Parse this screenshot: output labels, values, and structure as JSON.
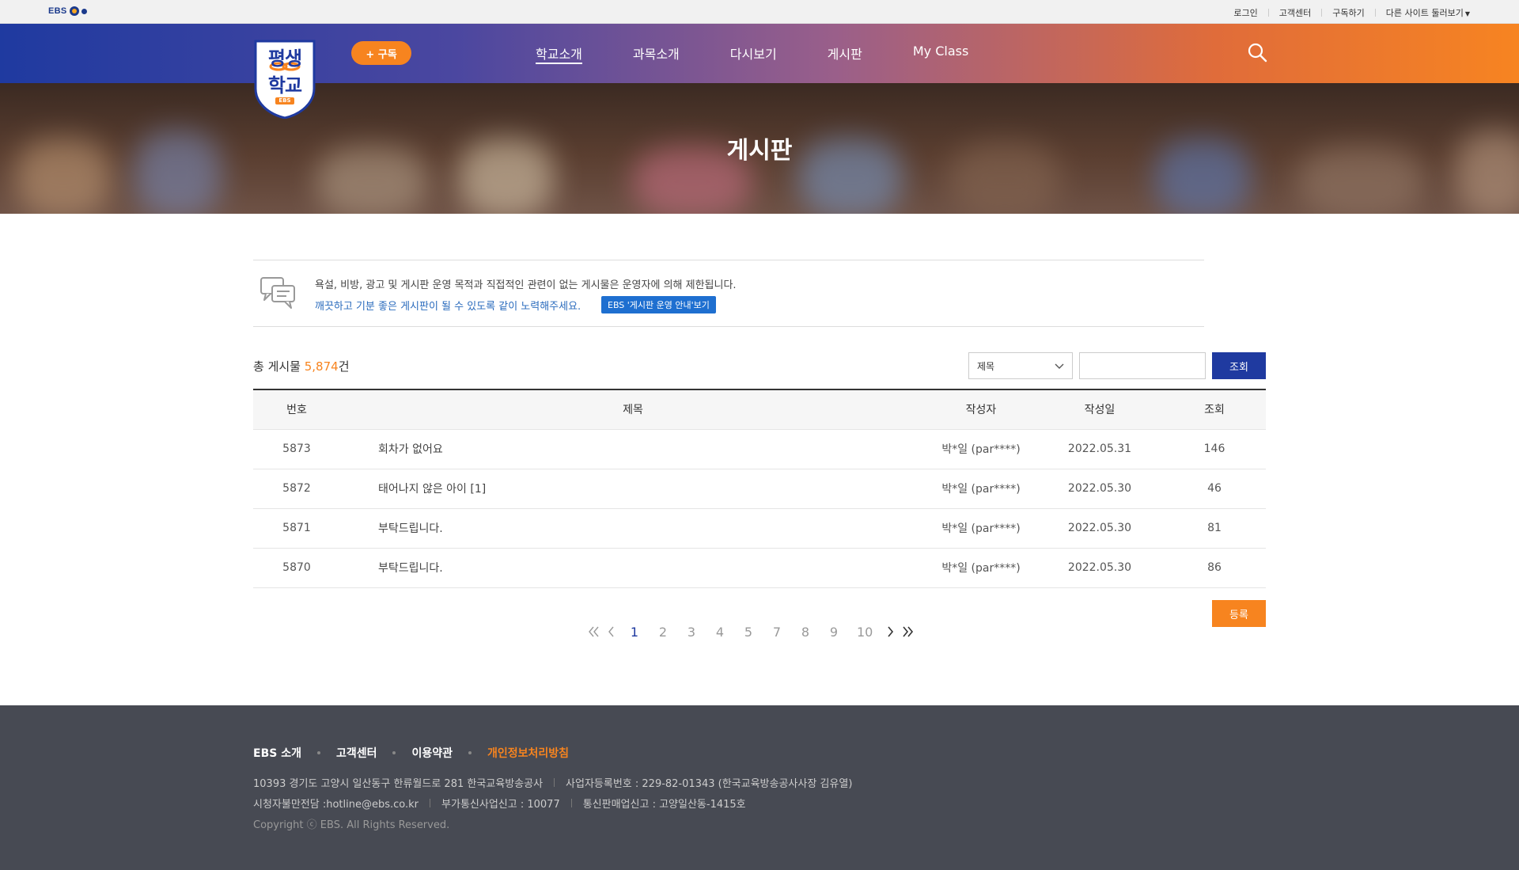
{
  "topbar": {
    "logo_text": "EBS",
    "links": [
      "로그인",
      "고객센터",
      "구독하기",
      "다른 사이트 둘러보기"
    ]
  },
  "header": {
    "brand_line1": "평생",
    "brand_line2": "학교",
    "brand_badge": "EBS",
    "subscribe_label": "+ 구독",
    "menu": [
      "학교소개",
      "과목소개",
      "다시보기",
      "게시판",
      "My Class"
    ],
    "active_menu": "학교소개"
  },
  "hero": {
    "title": "게시판"
  },
  "notice": {
    "line1": "욕설, 비방, 광고 및 게시판 운영 목적과 직접적인 관련이 없는 게시물은 운영자에 의해 제한됩니다.",
    "line2": "깨끗하고 기분 좋은 게시판이 될 수 있도록 같이 노력해주세요.",
    "guide_button": "EBS '게시판 운영 안내'보기"
  },
  "list": {
    "total_prefix": "총 게시물 ",
    "total_count": "5,874",
    "total_suffix": "건",
    "search_select_value": "제목",
    "search_input_value": "",
    "search_button": "조회",
    "write_button": "등록"
  },
  "table": {
    "headers": [
      "번호",
      "제목",
      "작성자",
      "작성일",
      "조회"
    ],
    "rows": [
      {
        "no": "5873",
        "title": "회차가 없어요",
        "author": "박*일 (par****)",
        "date": "2022.05.31",
        "views": "146"
      },
      {
        "no": "5872",
        "title": "태어나지 않은 아이 [1]",
        "author": "박*일 (par****)",
        "date": "2022.05.30",
        "views": "46"
      },
      {
        "no": "5871",
        "title": "부탁드립니다.",
        "author": "박*일 (par****)",
        "date": "2022.05.30",
        "views": "81"
      },
      {
        "no": "5870",
        "title": "부탁드립니다.",
        "author": "박*일 (par****)",
        "date": "2022.05.30",
        "views": "86"
      }
    ]
  },
  "paging": {
    "pages": [
      "1",
      "2",
      "3",
      "4",
      "5",
      "7",
      "8",
      "9",
      "10"
    ],
    "current": "1"
  },
  "footer": {
    "links": [
      "EBS 소개",
      "고객센터",
      "이용약관",
      "개인정보처리방침"
    ],
    "address": "10393 경기도 고양시 일산동구 한류월드로 281 한국교육방송공사",
    "business_no": "사업자등록번호 : 229-82-01343 (한국교육방송공사사장 김유열)",
    "complaint": "시청자불만전담 :hotline@ebs.co.kr",
    "vas_no": "부가통신사업신고 : 10077",
    "mail_order": "통신판매업신고 : 고양일산동-1415호",
    "copyright": "Copyright ⓒ EBS. All Rights Reserved."
  },
  "colors": {
    "accent_orange": "#f7841f",
    "brand_blue": "#1f3aa0",
    "footer_bg": "#474a53"
  }
}
